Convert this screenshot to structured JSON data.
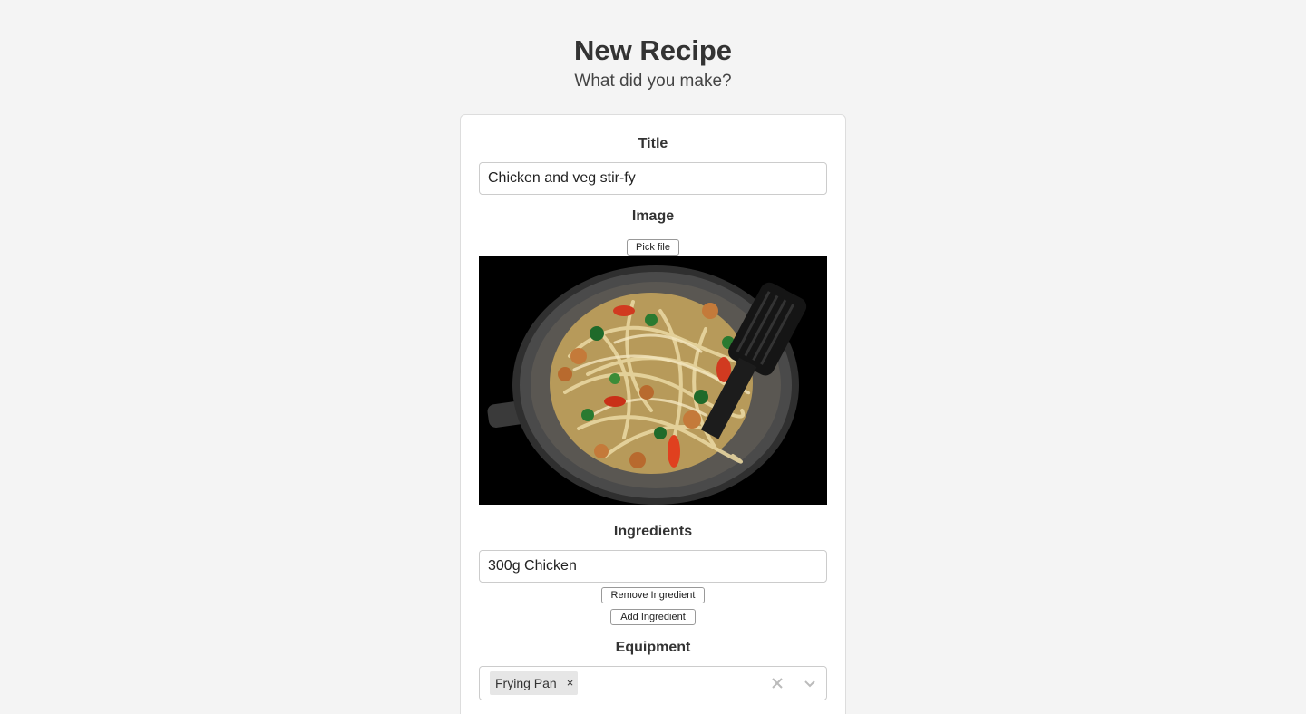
{
  "header": {
    "title": "New Recipe",
    "subtitle": "What did you make?"
  },
  "form": {
    "title_label": "Title",
    "title_value": "Chicken and veg stir-fy",
    "image_label": "Image",
    "pick_file_label": "Pick file",
    "image_alt": "Chicken and veg stir-fry in a wok",
    "ingredients_label": "Ingredients",
    "ingredients": [
      "300g Chicken"
    ],
    "remove_ingredient_label": "Remove Ingredient",
    "add_ingredient_label": "Add Ingredient",
    "equipment_label": "Equipment",
    "equipment_selected": [
      "Frying Pan"
    ],
    "tag_remove_glyph": "×"
  },
  "icons": {
    "clear": "close-icon",
    "dropdown": "chevron-down-icon"
  },
  "colors": {
    "background": "#f4f4f4",
    "card": "#ffffff",
    "text": "#333333",
    "tag_bg": "#e6e6e6"
  }
}
